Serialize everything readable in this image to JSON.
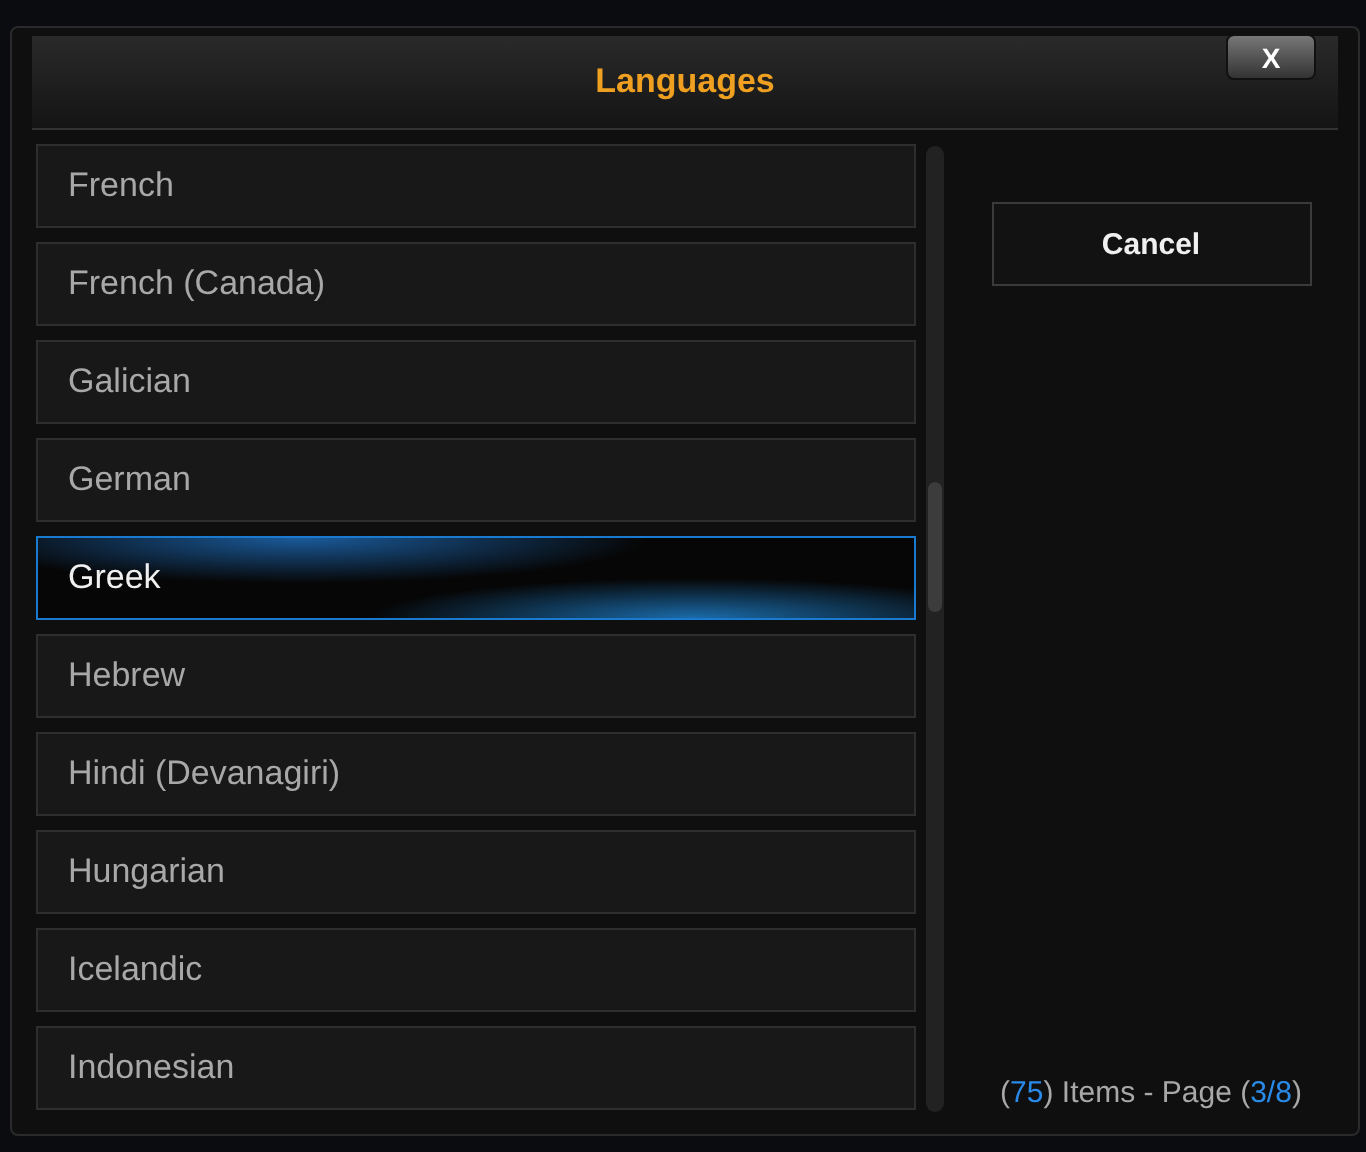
{
  "dialog": {
    "title": "Languages",
    "close_label": "X"
  },
  "items": [
    {
      "label": "French",
      "selected": false
    },
    {
      "label": "French (Canada)",
      "selected": false
    },
    {
      "label": "Galician",
      "selected": false
    },
    {
      "label": "German",
      "selected": false
    },
    {
      "label": "Greek",
      "selected": true
    },
    {
      "label": "Hebrew",
      "selected": false
    },
    {
      "label": "Hindi (Devanagiri)",
      "selected": false
    },
    {
      "label": "Hungarian",
      "selected": false
    },
    {
      "label": "Icelandic",
      "selected": false
    },
    {
      "label": "Indonesian",
      "selected": false
    }
  ],
  "cancel_button": "Cancel",
  "footer": {
    "open": "(",
    "count": "75",
    "items_text": ") Items - Page (",
    "page": "3/8",
    "close": ")"
  }
}
